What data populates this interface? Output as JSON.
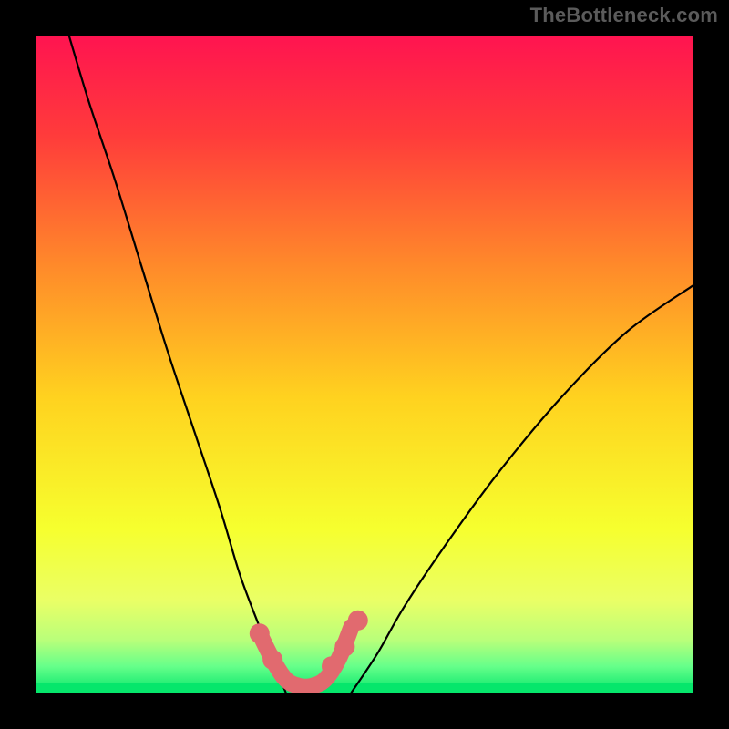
{
  "watermark": "TheBottleneck.com",
  "chart_data": {
    "type": "line",
    "title": "",
    "xlabel": "",
    "ylabel": "",
    "xlim": [
      0,
      100
    ],
    "ylim": [
      0,
      100
    ],
    "grid": false,
    "legend": false,
    "gradient_stops": [
      {
        "offset": 0.0,
        "color": "#ff1450"
      },
      {
        "offset": 0.15,
        "color": "#ff3b3b"
      },
      {
        "offset": 0.35,
        "color": "#ff8a2a"
      },
      {
        "offset": 0.55,
        "color": "#ffd21f"
      },
      {
        "offset": 0.75,
        "color": "#f6ff2e"
      },
      {
        "offset": 0.86,
        "color": "#eaff66"
      },
      {
        "offset": 0.92,
        "color": "#b9ff7a"
      },
      {
        "offset": 0.96,
        "color": "#66ff8a"
      },
      {
        "offset": 1.0,
        "color": "#06e66b"
      }
    ],
    "series": [
      {
        "name": "left-curve",
        "type": "line",
        "color": "#000000",
        "x": [
          5,
          8,
          12,
          16,
          20,
          24,
          28,
          31,
          34,
          36,
          38
        ],
        "values": [
          100,
          90,
          78,
          65,
          52,
          40,
          28,
          18,
          10,
          5,
          0
        ]
      },
      {
        "name": "right-curve",
        "type": "line",
        "color": "#000000",
        "x": [
          48,
          52,
          56,
          62,
          70,
          80,
          90,
          100
        ],
        "values": [
          0,
          6,
          13,
          22,
          33,
          45,
          55,
          62
        ]
      },
      {
        "name": "marker-band",
        "type": "line",
        "color": "#e16a6f",
        "x": [
          34,
          36,
          38,
          40,
          42,
          44,
          46,
          48
        ],
        "values": [
          9,
          5,
          2,
          1,
          1,
          2,
          5,
          10
        ]
      }
    ],
    "markers": [
      {
        "x": 34,
        "y": 9
      },
      {
        "x": 36,
        "y": 5
      },
      {
        "x": 45,
        "y": 4
      },
      {
        "x": 47,
        "y": 7
      },
      {
        "x": 49,
        "y": 11
      }
    ],
    "marker_color": "#e16a6f",
    "band_min_y": 1,
    "bottom_band_color": "#06e66b"
  }
}
